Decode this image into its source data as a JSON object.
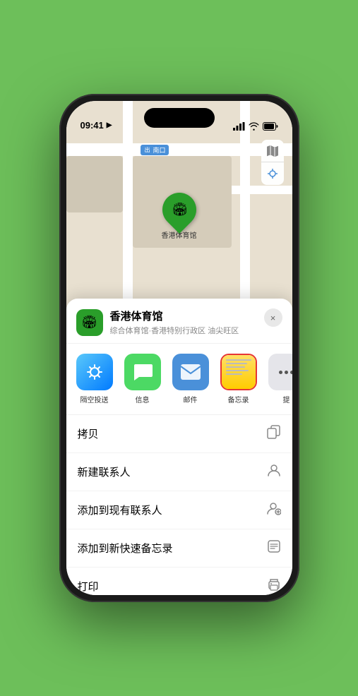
{
  "status_bar": {
    "time": "09:41",
    "location_icon": "▶"
  },
  "map": {
    "label": "南口",
    "map_icon": "🗺",
    "location_icon": "⬆"
  },
  "venue": {
    "name": "香港体育馆",
    "subtitle": "综合体育馆·香港特别行政区 油尖旺区",
    "pin_label": "香港体育馆",
    "emoji": "🏟"
  },
  "share_items": [
    {
      "id": "airdrop",
      "label": "隔空投送",
      "type": "airdrop"
    },
    {
      "id": "message",
      "label": "信息",
      "type": "message"
    },
    {
      "id": "mail",
      "label": "邮件",
      "type": "mail"
    },
    {
      "id": "notes",
      "label": "备忘录",
      "type": "notes"
    },
    {
      "id": "more",
      "label": "提",
      "type": "more"
    }
  ],
  "actions": [
    {
      "id": "copy",
      "label": "拷贝",
      "icon": "copy"
    },
    {
      "id": "new-contact",
      "label": "新建联系人",
      "icon": "person"
    },
    {
      "id": "add-contact",
      "label": "添加到现有联系人",
      "icon": "person-add"
    },
    {
      "id": "quick-note",
      "label": "添加到新快速备忘录",
      "icon": "note"
    },
    {
      "id": "print",
      "label": "打印",
      "icon": "print"
    }
  ],
  "close_label": "×"
}
